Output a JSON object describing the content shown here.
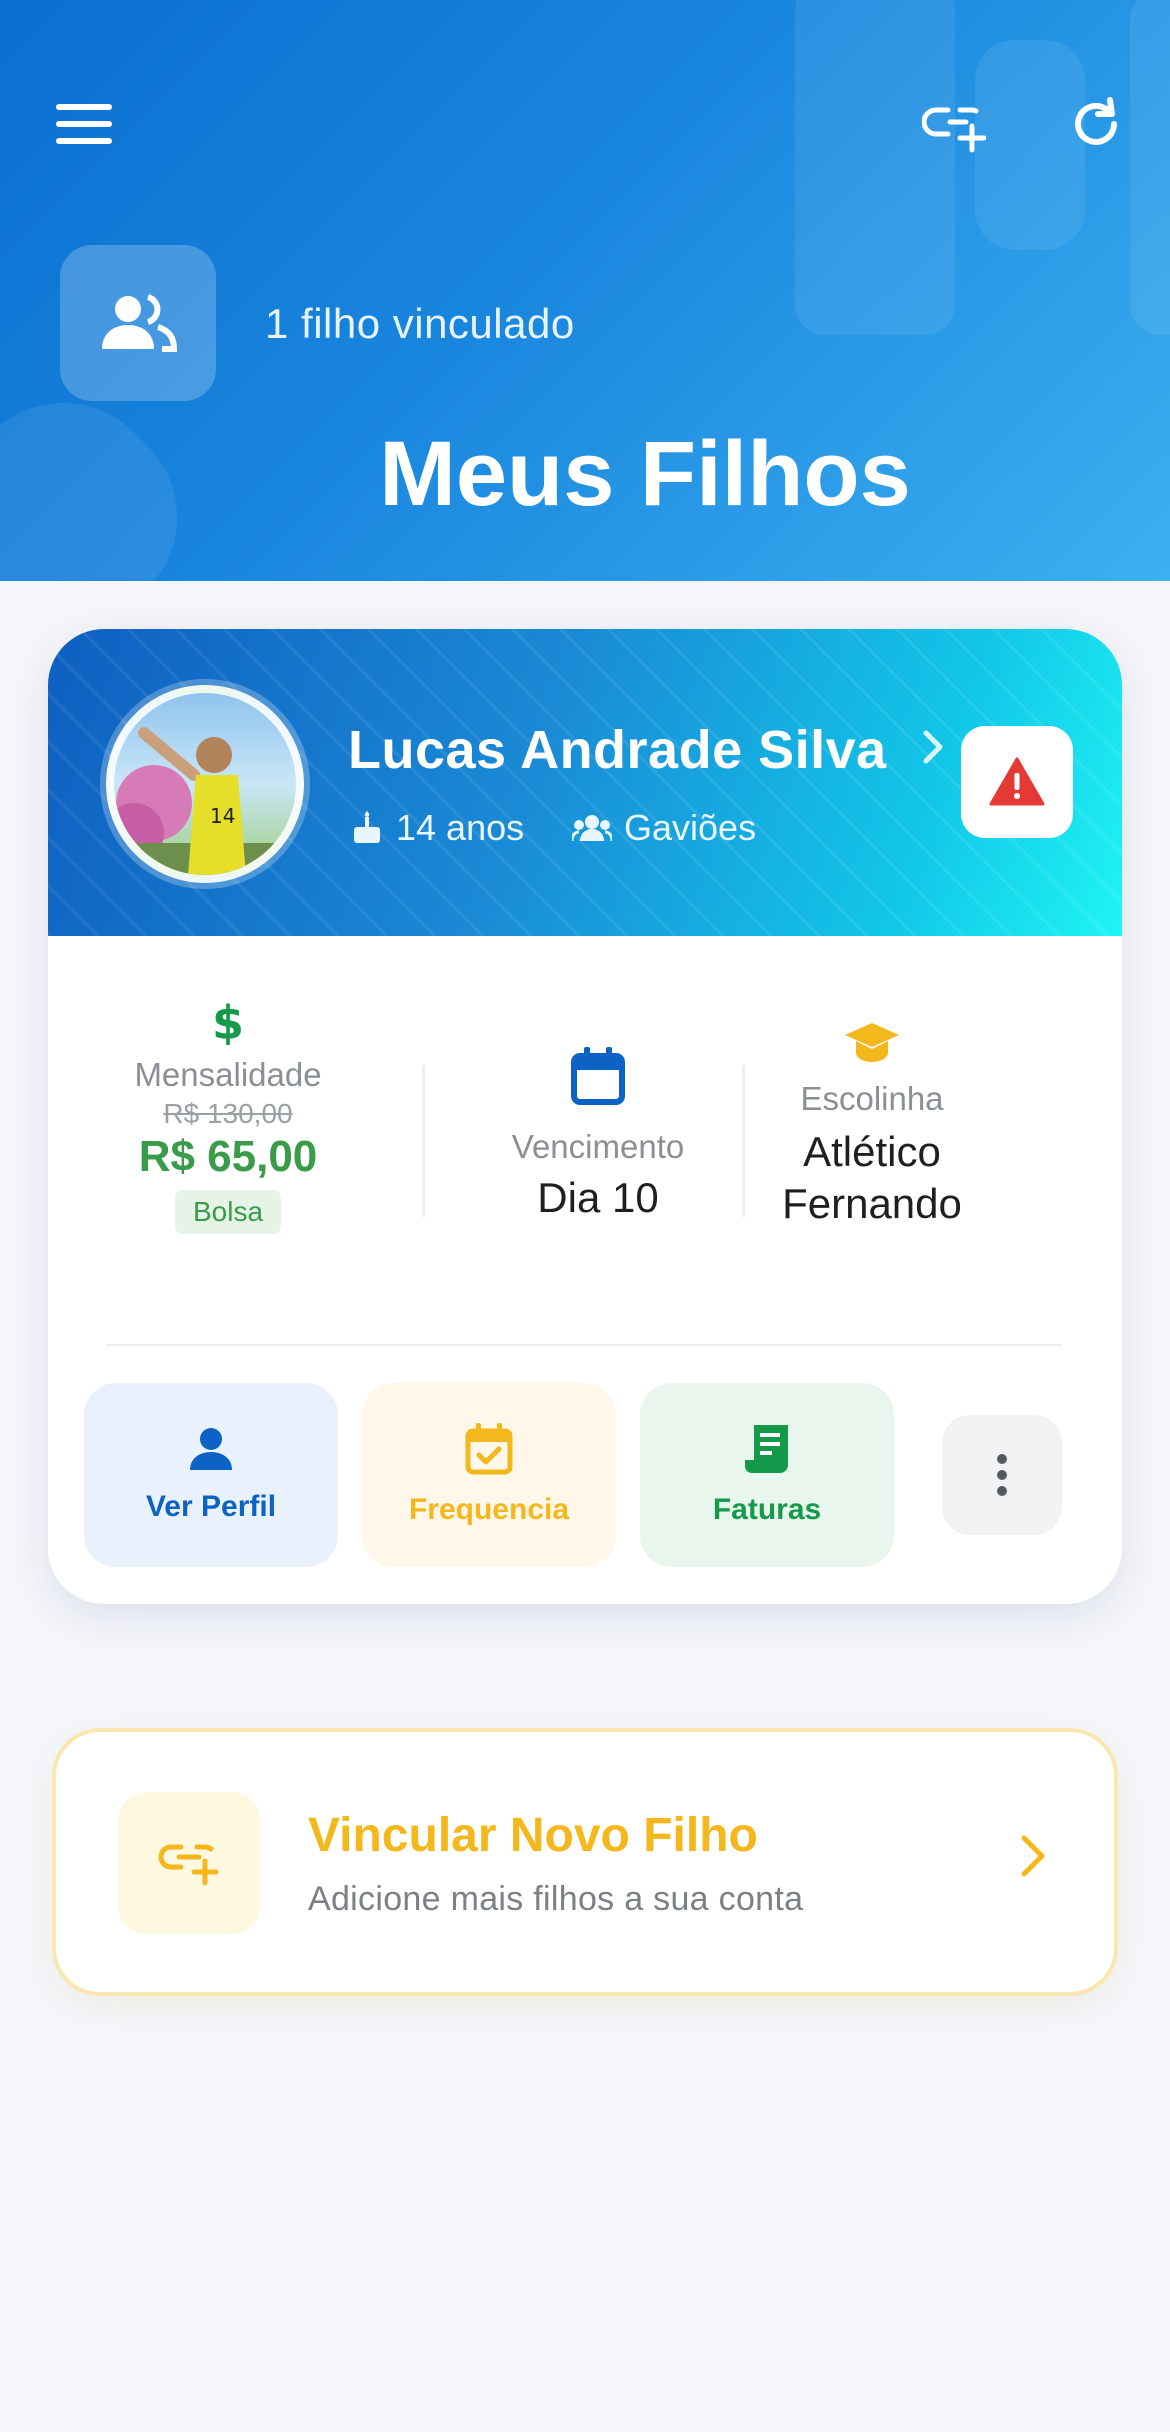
{
  "header": {
    "counter_text": "1 filho vinculado",
    "title": "Meus Filhos"
  },
  "child": {
    "name": "Lucas Andrade Silva",
    "age": "14 anos",
    "team": "Gaviões",
    "fee": {
      "label": "Mensalidade",
      "old_price": "R$ 130,00",
      "price": "R$ 65,00",
      "badge": "Bolsa"
    },
    "due": {
      "label": "Vencimento",
      "value": "Dia 10"
    },
    "school": {
      "label": "Escolinha",
      "value_line1": "Atlético",
      "value_line2": "Fernando"
    },
    "actions": [
      {
        "label": "Ver Perfil",
        "color": "#0c63c5",
        "bg": "#e9f2fc"
      },
      {
        "label": "Frequencia",
        "color": "#f5b81c",
        "bg": "#fff8ea"
      },
      {
        "label": "Faturas",
        "color": "#159a4c",
        "bg": "#e8f6ee"
      }
    ]
  },
  "link_card": {
    "title": "Vincular Novo Filho",
    "subtitle": "Adicione mais filhos a sua conta"
  },
  "colors": {
    "primary": "#0a6fd0",
    "accent_yellow": "#f5b81c",
    "success": "#3a9b48",
    "danger": "#e53935"
  }
}
